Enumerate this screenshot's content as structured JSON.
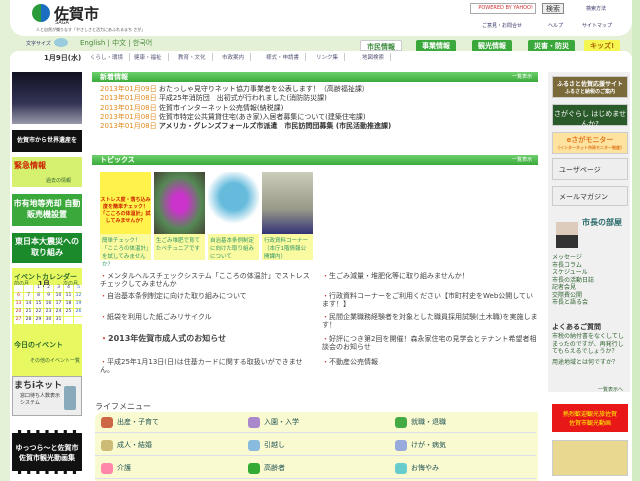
{
  "header": {
    "site_name": "佐賀市",
    "site_sub": "SAGA",
    "tagline": "人と自然が織りなす「やさしさと活力にあふれるまち さが」",
    "search_placeholder": "POWERED BY YAHOO!",
    "search_button": "検索",
    "search_help": "検索方法",
    "contact": "ご意見・お問合せ",
    "help": "ヘルプ",
    "sitemap": "サイトマップ",
    "font_size_label": "文字サイズ",
    "lang_en": "English",
    "lang_zh": "中文",
    "lang_ko": "한국어",
    "date": "1月9日(水)"
  },
  "nav": [
    "くらし・環境",
    "健康・福祉",
    "教育・文化",
    "市政案内",
    "様式・申請書",
    "リンク集",
    "地図検索"
  ],
  "category_tabs": [
    "市民情報",
    "事業情報",
    "観光情報",
    "災害・防災",
    "キッズ!"
  ],
  "left": {
    "banner1": "佐賀市から世界遺産を",
    "emergency_title": "緊急情報",
    "emergency_past": "過去の情報",
    "banner2": "市有地等売却 自動販売機設置",
    "banner3": "東日本大震災への取り組み",
    "calendar_title": "イベントカレンダー",
    "prev": "前の月",
    "month": "1月",
    "next": "次の月",
    "days": [
      "",
      "",
      "1",
      "2",
      "3",
      "4",
      "5",
      "6",
      "7",
      "8",
      "9",
      "10",
      "11",
      "12",
      "13",
      "14",
      "15",
      "16",
      "17",
      "18",
      "19",
      "20",
      "21",
      "22",
      "23",
      "24",
      "25",
      "26",
      "27",
      "28",
      "29",
      "30",
      "31",
      "",
      ""
    ],
    "today_event": "今日のイベント",
    "other_events": "その他のイベント一覧",
    "machi_title": "まちiネット",
    "machi_sub": "窓口待ち人数表示システム",
    "video": "ゆっつら～と佐賀市 佐賀市観光動画集"
  },
  "news": {
    "title": "新着情報",
    "more": "一覧表示",
    "items": [
      {
        "date": "2013年01月09日",
        "text": "おたっしゃ見守りネット協力事業者を公表します！（高齢福祉課）",
        "bold": false
      },
      {
        "date": "2013年01月08日",
        "text": "平成25年消防団　出初式が行われました(消防防災課)",
        "bold": false
      },
      {
        "date": "2013年01月08日",
        "text": "佐賀市インターネット公売情報(納税課)",
        "bold": false
      },
      {
        "date": "2013年01月08日",
        "text": "佐賀市特定公共賃貸住宅(あき家)入居者募集について(建築住宅課)",
        "bold": false
      },
      {
        "date": "2013年01月08日",
        "text": "アメリカ・グレンズフォールズ市派遣　市民訪問団募集 (市民活動推進課)",
        "bold": true
      }
    ]
  },
  "topics": {
    "title": "トピックス",
    "more": "一覧表示",
    "cards": [
      "簡単チェック！「こころの体温計」を試してみませんか？",
      "生ごみ堆肥で育てたペチュニアです",
      "自治基本条例制定に向けた取り組みについて",
      "行政資料コーナー（本庁1階情報公開課内）"
    ],
    "card1_img_text": "ストレス度・落ち込み度を簡単チェック！「こころの体温計」試してみませんか？",
    "list": [
      "メンタルヘルスチェックシステム「こころの体温計」でストレスチェックしてみませんか",
      "生ごみ減量・堆肥化等に取り組みませんか！",
      "自治基本条例制定に向けた取り組みについて",
      "行政資料コーナーをご利用ください【市町村史をWeb公開しています！】",
      "紙袋を利用した紙ごみリサイクル",
      "民間企業職務経験者を対象とした職員採用試験(土木職)を実施します！",
      "2013年佐賀市成人式のお知らせ",
      "好評につき第2回を開催！森永家住宅の見学会とテナント希望者相談会のお知らせ",
      "平成25年1月13日(日)は住基カードに関する取扱いができません。",
      "不動産公売情報"
    ]
  },
  "life": {
    "title": "ライフメニュー",
    "items": [
      "出産・子育て",
      "入園・入学",
      "就職・退職",
      "成人・結婚",
      "引越し",
      "けが・病気",
      "介護",
      "高齢者",
      "お悔やみ"
    ]
  },
  "right": {
    "furusato": "ふるさと佐賀応援サイト",
    "furusato_sub": "ふるさと納税のご案内",
    "sagagurashi": "さがぐらし はじめませんか?",
    "monitor": "eさがモニター",
    "monitor_sub": "(インターネット市政モニター制度)",
    "userpage": "ユーザページ",
    "mailmag": "メールマガジン",
    "mayor_title": "市長の部屋",
    "mayor_links": [
      "メッセージ",
      "市長コラム",
      "スケジュール",
      "市長の活動日誌",
      "記者会見",
      "交際費公開",
      "市長と語る会"
    ],
    "faq_title": "よくあるご質問",
    "faq": [
      "市税の納付書をなくしてしまったのですが、再発行してもらえるでしょうか？",
      "用途地域とは何ですか？"
    ],
    "faq_more": "一覧表示へ",
    "kankou": "熱烈歓迎観光旅佐賀",
    "kankou_sub": "佐賀市観光動画"
  }
}
